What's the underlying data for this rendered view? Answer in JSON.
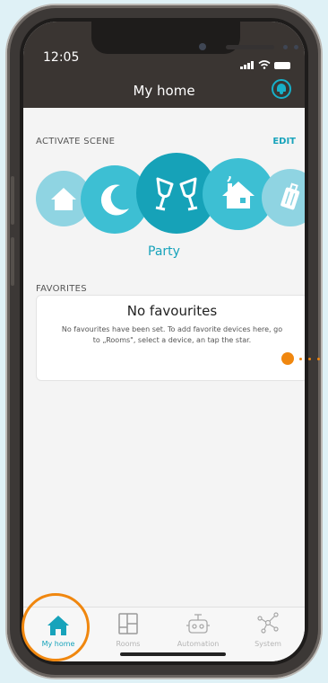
{
  "status": {
    "time": "12:05"
  },
  "header": {
    "title": "My home"
  },
  "scenes": {
    "label": "ACTIVATE SCENE",
    "edit_label": "EDIT",
    "selected_label": "Party",
    "items": [
      {
        "name": "home",
        "icon": "house-icon"
      },
      {
        "name": "night",
        "icon": "moon-icon"
      },
      {
        "name": "party",
        "icon": "glasses-icon",
        "active": true
      },
      {
        "name": "away",
        "icon": "house-smoke-icon"
      },
      {
        "name": "travel",
        "icon": "luggage-icon"
      }
    ]
  },
  "favorites": {
    "label": "FAVORITES",
    "empty_title": "No favourites",
    "empty_text": "No favourites have been set. To add favorite devices here, go to „Rooms\", select a device, an tap the star."
  },
  "tabbar": {
    "items": [
      {
        "label": "My home",
        "icon": "home-icon",
        "active": true
      },
      {
        "label": "Rooms",
        "icon": "rooms-icon"
      },
      {
        "label": "Automation",
        "icon": "robot-icon"
      },
      {
        "label": "System",
        "icon": "network-icon"
      }
    ]
  },
  "colors": {
    "accent": "#17a3bb",
    "highlight": "#f0870f",
    "header": "#3a3532"
  }
}
